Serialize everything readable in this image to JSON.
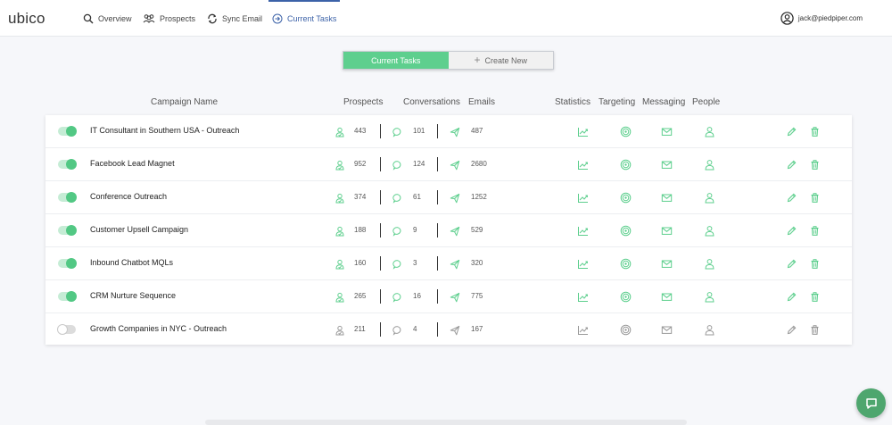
{
  "app": {
    "logo": "ubico"
  },
  "nav": {
    "items": [
      {
        "label": "Overview",
        "icon": "search-icon"
      },
      {
        "label": "Prospects",
        "icon": "users-icon"
      },
      {
        "label": "Sync Email",
        "icon": "sync-icon"
      },
      {
        "label": "Current Tasks",
        "icon": "arrow-circle-icon",
        "active": true
      }
    ]
  },
  "user": {
    "email": "jack@piedpiper.com"
  },
  "toggle": {
    "current": "Current Tasks",
    "create": "Create New"
  },
  "columns": {
    "name": "Campaign Name",
    "prospects": "Prospects",
    "conversations": "Conversations",
    "emails": "Emails",
    "statistics": "Statistics",
    "targeting": "Targeting",
    "messaging": "Messaging",
    "people": "People"
  },
  "colors": {
    "accent": "#5ecf8e",
    "active_nav": "#3c62a8",
    "inactive_icon": "#9a9a9a"
  },
  "campaigns": [
    {
      "name": "IT Consultant in Southern USA - Outreach",
      "prospects": "443",
      "conversations": "101",
      "emails": "487",
      "active": true
    },
    {
      "name": "Facebook Lead Magnet",
      "prospects": "952",
      "conversations": "124",
      "emails": "2680",
      "active": true
    },
    {
      "name": "Conference Outreach",
      "prospects": "374",
      "conversations": "61",
      "emails": "1252",
      "active": true
    },
    {
      "name": "Customer Upsell Campaign",
      "prospects": "188",
      "conversations": "9",
      "emails": "529",
      "active": true
    },
    {
      "name": "Inbound Chatbot MQLs",
      "prospects": "160",
      "conversations": "3",
      "emails": "320",
      "active": true
    },
    {
      "name": "CRM Nurture Sequence",
      "prospects": "265",
      "conversations": "16",
      "emails": "775",
      "active": true
    },
    {
      "name": "Growth Companies in NYC - Outreach",
      "prospects": "211",
      "conversations": "4",
      "emails": "167",
      "active": false
    }
  ]
}
